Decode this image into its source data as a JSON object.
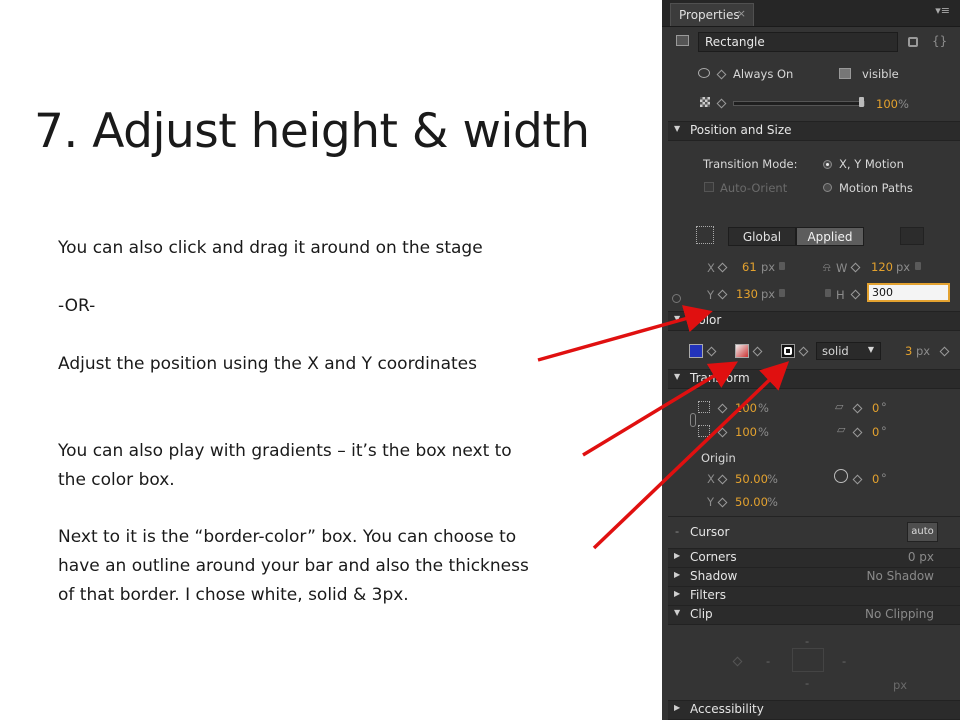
{
  "slide": {
    "title": "7. Adjust height & width",
    "lines": [
      "You can also click and drag it around on the stage",
      "-OR-",
      "Adjust the position using the X and Y coordinates",
      "You can also play with gradients – it’s the box next to",
      "the color box.",
      "Next to it is the “border-color” box. You can choose to",
      "have an outline around your bar and also the thickness",
      "of that border. I chose white, solid & 3px."
    ]
  },
  "panel": {
    "tab_label": "Properties",
    "tab_close": "×",
    "menu_glyph": "▾≡",
    "element_name": "Rectangle",
    "cursor_label": "Always On",
    "visibility": "visible",
    "opacity": "100",
    "opacity_unit": "%",
    "sections": {
      "position_size": "Position and Size",
      "color": "Color",
      "transform": "Transform",
      "cursor": "Cursor",
      "corners": "Corners",
      "shadow": "Shadow",
      "filters": "Filters",
      "clip": "Clip",
      "accessibility": "Accessibility"
    },
    "transition_label": "Transition Mode:",
    "transition_opt1": "X, Y Motion",
    "transition_opt2": "Motion Paths",
    "auto_orient": "Auto-Orient",
    "global_btn": "Global",
    "applied_btn": "Applied",
    "pos": {
      "x_label": "X",
      "x_val": "61",
      "x_unit": "px",
      "y_label": "Y",
      "y_val": "130",
      "y_unit": "px",
      "w_label": "W",
      "w_val": "120",
      "w_unit": "px",
      "h_label": "H",
      "h_val": "300"
    },
    "color": {
      "fill": "#2233bb",
      "border_style": "solid",
      "border_width": "3",
      "border_unit": "px"
    },
    "transform": {
      "scale_x": "100",
      "scale_y": "100",
      "pct": "%",
      "skew_x": "0",
      "skew_y": "0",
      "deg": "°",
      "origin_label": "Origin",
      "ox_label": "X",
      "ox_val": "50.00",
      "oy_label": "Y",
      "oy_val": "50.00",
      "rotate": "0"
    },
    "cursor_auto": "auto",
    "corners_val": "0 px",
    "shadow_val": "No Shadow",
    "clip_val": "No Clipping",
    "clip_dash": "-",
    "clip_px": "px"
  }
}
